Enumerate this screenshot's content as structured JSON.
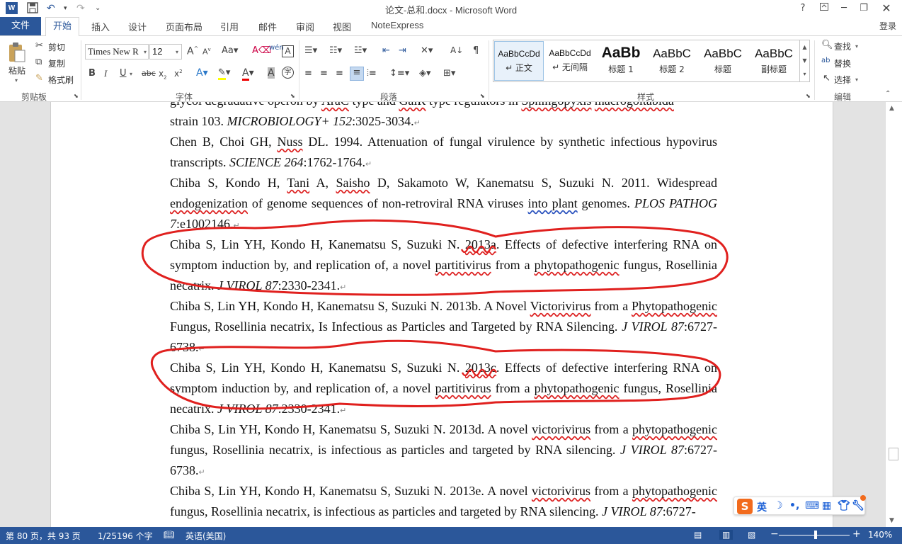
{
  "window": {
    "title": "论文-总和.docx - Microsoft Word",
    "help": "?",
    "login": "登录"
  },
  "qat": {
    "undo": "↶",
    "redo": "↷",
    "more": "⌄"
  },
  "tabs": {
    "file": "文件",
    "home": "开始",
    "insert": "插入",
    "design": "设计",
    "layout": "页面布局",
    "references": "引用",
    "mailings": "邮件",
    "review": "审阅",
    "view": "视图",
    "noteexpress": "NoteExpress"
  },
  "ribbon": {
    "clipboard": {
      "paste": "粘贴",
      "cut": "剪切",
      "copy": "复制",
      "format_painter": "格式刷",
      "label": "剪贴板"
    },
    "font": {
      "name": "Times New R",
      "size": "12",
      "label": "字体"
    },
    "paragraph": {
      "label": "段落"
    },
    "styles": {
      "label": "样式",
      "items": [
        {
          "preview": "AaBbCcDd",
          "name": "↵ 正文"
        },
        {
          "preview": "AaBbCcDd",
          "name": "↵ 无间隔"
        },
        {
          "preview": "AaBb",
          "name": "标题 1"
        },
        {
          "preview": "AaBbC",
          "name": "标题 2"
        },
        {
          "preview": "AaBbC",
          "name": "标题"
        },
        {
          "preview": "AaBbC",
          "name": "副标题"
        }
      ]
    },
    "editing": {
      "find": "查找",
      "replace": "替换",
      "select": "选择",
      "label": "编辑"
    }
  },
  "document": {
    "paragraphs": [
      {
        "pre": "glycol degradative operon by ",
        "u1": "AraC",
        "mid": " type and ",
        "u2": "GalR",
        "mid2": " type regulators in ",
        "u3": "Sphingopyxis",
        "sp": " ",
        "u4": "macrogoltabida",
        "line2": "strain 103. ",
        "journal": "MICROBIOLOGY+ 152",
        "tail": ":3025-3034."
      },
      {
        "text1": "Chen B, Choi GH, ",
        "u1": "Nuss",
        "text2": " DL. 1994. Attenuation of fungal virulence by synthetic infectious hypovirus transcripts. ",
        "journal": "SCIENCE 264",
        "tail": ":1762-1764."
      },
      {
        "text1": "Chiba S, Kondo H, ",
        "u1": "Tani",
        "text2": " A, ",
        "u2": "Saisho",
        "text3": " D, Sakamoto W, Kanematsu S, Suzuki N. 2011. Widespread ",
        "u3": "endogenization",
        "text4": " of genome sequences of non-retroviral RNA viruses ",
        "u4": "into  ",
        "text5": " ",
        "u5": "plant",
        "text6": " genomes. ",
        "journal": "PLOS PATHOG 7",
        "tail": ":e1002146."
      },
      {
        "text1": "Chiba S, Lin YH, Kondo H, Kanematsu S, Suzuki N. ",
        "u1": "2013a",
        "text2": ". Effects of defective interfering RNA on symptom induction by, and replication of, a novel ",
        "u2": "partitivirus",
        "text3": " from a ",
        "u3": "phytopathogenic",
        "text4": " fungus, Rosellinia necatrix. ",
        "journal": "J VIROL 87",
        "tail": ":2330-2341."
      },
      {
        "text1": "Chiba S, Lin YH, Kondo H, Kanematsu S, Suzuki N. 2013b. A Novel ",
        "u1": "Victorivirus",
        "text2": " from a ",
        "u2": "Phytopathogenic",
        "text3": " Fungus, Rosellinia necatrix, Is Infectious as Particles and Targeted by RNA Silencing. ",
        "journal": "J VIROL 87",
        "tail": ":6727-6738."
      },
      {
        "text1": "Chiba S, Lin YH, Kondo H, Kanematsu S, Suzuki N. ",
        "u1": "2013c",
        "text2": ". Effects of defective interfering RNA on symptom induction by, and replication of, a novel ",
        "u2": "partitivirus",
        "text3": " from a ",
        "u3": "phytopathogenic",
        "text4": " fungus, Rosellinia necatrix. ",
        "journal": "J VIROL 87",
        "tail": ":2330-2341."
      },
      {
        "text1": "Chiba S, Lin YH, Kondo H, Kanematsu S, Suzuki N. 2013d. A novel ",
        "u1": "victorivirus",
        "text2": " from a ",
        "u2": "phytopathogenic",
        "text3": " fungus, Rosellinia necatrix, is infectious as particles and targeted by RNA silencing. ",
        "journal": "J VIROL 87",
        "tail": ":6727-6738."
      },
      {
        "text1": "Chiba S, Lin YH, Kondo H, Kanematsu S, Suzuki N. 2013e. A novel ",
        "u1": "victorivirus",
        "text2": " from a ",
        "u2": "phytopathogenic",
        "text3": " fungus, Rosellinia necatrix, is infectious as particles and targeted by RNA silencing. ",
        "journal": "J VIROL 87",
        "tail": ":6727-"
      }
    ],
    "para_mark": "↵"
  },
  "statusbar": {
    "page": "第 80 页，共 93 页",
    "words": "1/25196 个字",
    "language": "英语(美国)",
    "zoom": "140%",
    "zoom_minus": "−",
    "zoom_plus": "+"
  },
  "ime": {
    "logo": "S",
    "mode": "英"
  },
  "colors": {
    "accent": "#2b579a",
    "annotation": "#e0201e",
    "spell": "#d22",
    "grammar": "#2a52be"
  }
}
